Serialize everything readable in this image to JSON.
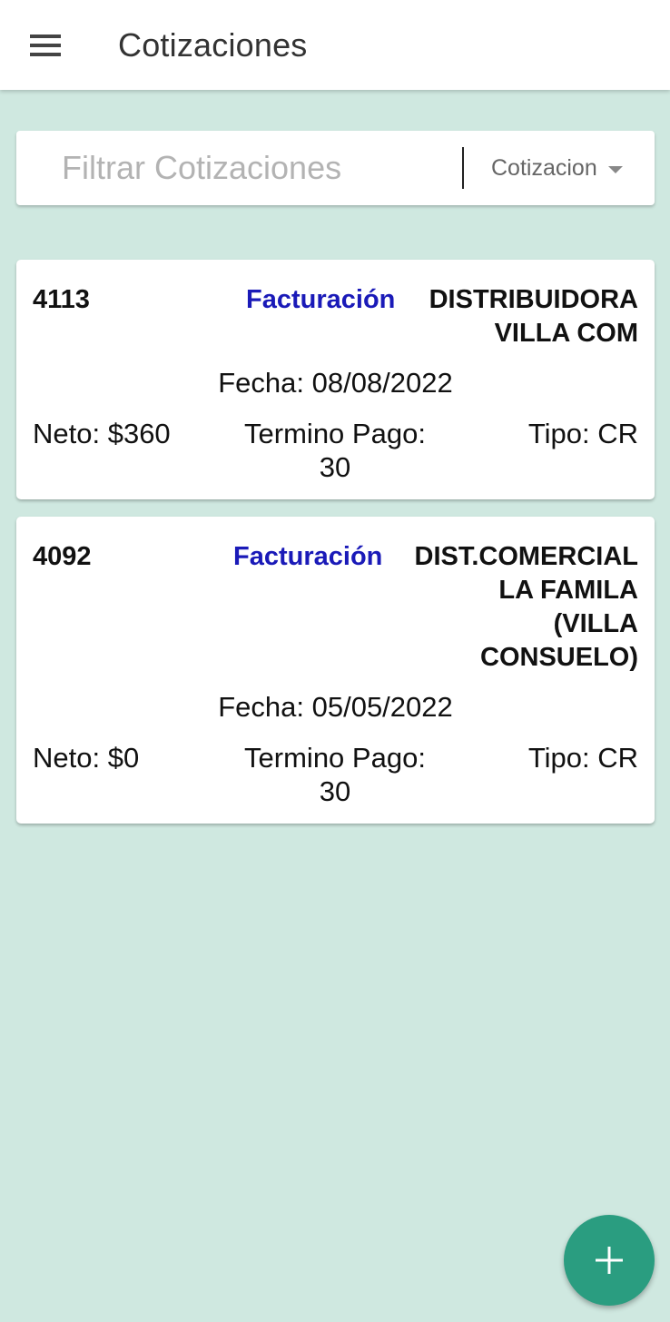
{
  "appbar": {
    "title": "Cotizaciones",
    "menu_icon": "menu-icon"
  },
  "filter": {
    "placeholder": "Filtrar Cotizaciones",
    "value": "",
    "select_value": "Cotizacion"
  },
  "quotes": [
    {
      "id": "4113",
      "status": "Facturación",
      "client_lines": [
        "DISTRIBUIDORA",
        "VILLA COM"
      ],
      "fecha": "Fecha: 08/08/2022",
      "neto": "Neto: $360",
      "termino_line1": "Termino Pago:",
      "termino_line2": "30",
      "tipo": "Tipo: CR"
    },
    {
      "id": "4092",
      "status": "Facturación",
      "client_lines": [
        "DIST.COMERCIAL",
        "LA FAMILA",
        "(VILLA",
        "CONSUELO)"
      ],
      "fecha": "Fecha: 05/05/2022",
      "neto": "Neto: $0",
      "termino_line1": "Termino Pago:",
      "termino_line2": "30",
      "tipo": "Tipo: CR"
    }
  ],
  "fab": {
    "icon": "add-icon"
  },
  "colors": {
    "background": "#cfe8e0",
    "status": "#1a1ab8",
    "fab": "#2a9d80"
  }
}
